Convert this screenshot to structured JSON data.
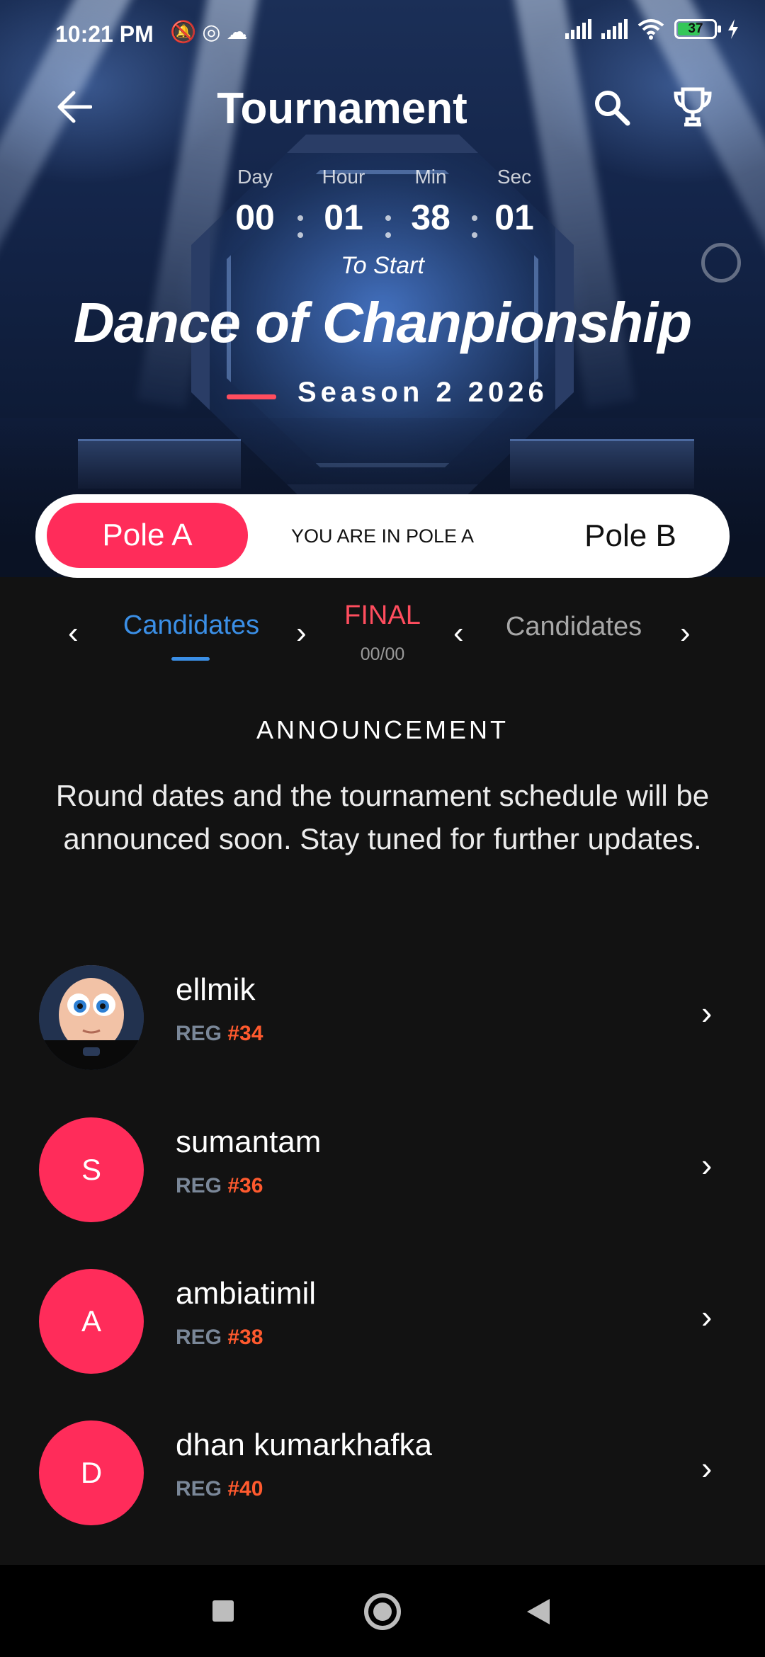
{
  "status_bar": {
    "time": "10:21 PM",
    "icons_left": [
      "mute-icon",
      "vpn-icon",
      "cloud-icon"
    ],
    "battery": "37"
  },
  "header": {
    "title": "Tournament",
    "back_icon": "arrow-left-icon",
    "search_icon": "search-icon",
    "trophy_icon": "trophy-icon"
  },
  "countdown": {
    "day_label": "Day",
    "day": "00",
    "hour_label": "Hour",
    "hour": "01",
    "min_label": "Min",
    "min": "38",
    "sec_label": "Sec",
    "sec": "01",
    "to_start": "To Start"
  },
  "event": {
    "title": "Dance of Chanpionship",
    "season": "Season 2 2026"
  },
  "pole": {
    "a_label": "Pole A",
    "status": "YOU ARE IN POLE A",
    "b_label": "Pole B"
  },
  "rounds": {
    "left_tab": "Candidates",
    "center_label": "FINAL",
    "center_sub": "00/00",
    "right_tab": "Candidates"
  },
  "announcement": {
    "title": "ANNOUNCEMENT",
    "text": "Round dates and the tournament schedule will be announced soon. Stay tuned for further updates."
  },
  "candidates": [
    {
      "name": "ellmik",
      "reg_prefix": "REG ",
      "reg_num": "#34",
      "initial": ""
    },
    {
      "name": "sumantam",
      "reg_prefix": "REG ",
      "reg_num": "#36",
      "initial": "S"
    },
    {
      "name": "ambiatimil",
      "reg_prefix": "REG ",
      "reg_num": "#38",
      "initial": "A"
    },
    {
      "name": "dhan kumarkhafka",
      "reg_prefix": "REG ",
      "reg_num": "#40",
      "initial": "D"
    }
  ],
  "colors": {
    "accent_pink": "#ff2c5a",
    "accent_blue": "#3b8fe6",
    "final_red": "#ff4d5e",
    "reg_orange": "#ff5a2e",
    "background": "#121212"
  }
}
